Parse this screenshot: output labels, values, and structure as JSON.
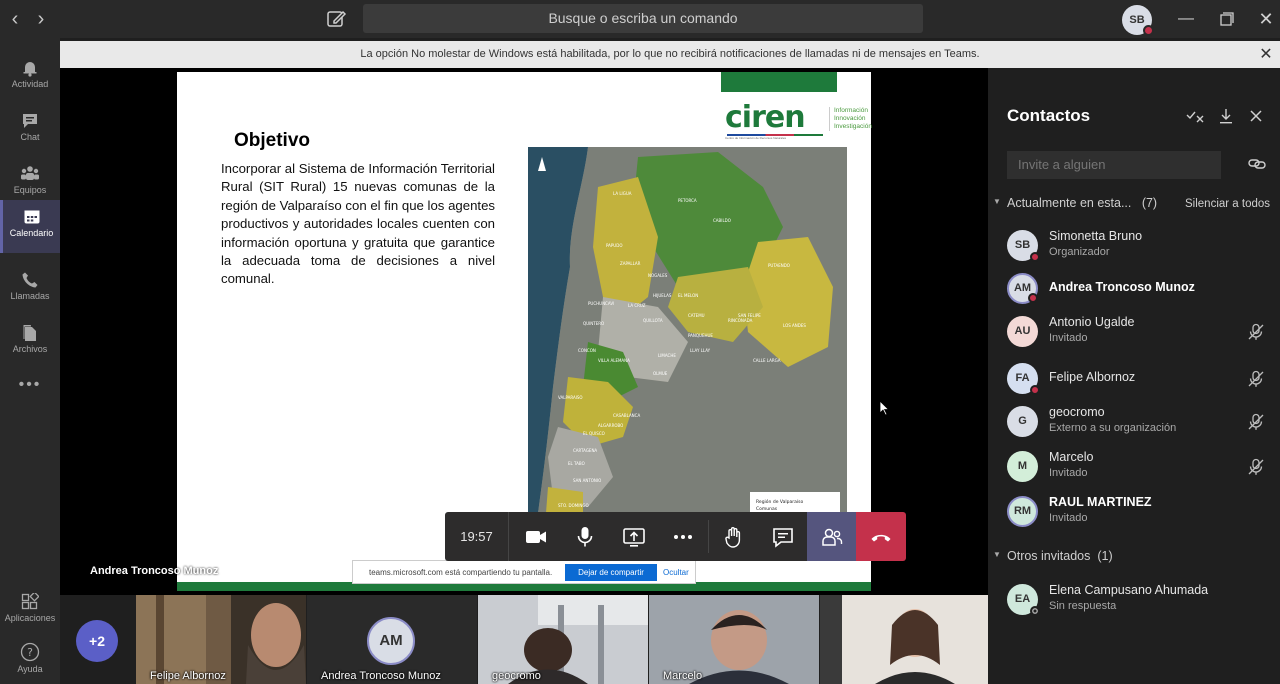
{
  "titlebar": {
    "search_placeholder": "Busque o escriba un comando",
    "me_initials": "SB"
  },
  "rail": {
    "items": [
      {
        "label": "Actividad",
        "icon": "bell-icon"
      },
      {
        "label": "Chat",
        "icon": "chat-icon"
      },
      {
        "label": "Equipos",
        "icon": "teams-icon"
      },
      {
        "label": "Calendario",
        "icon": "calendar-icon"
      },
      {
        "label": "Llamadas",
        "icon": "phone-icon"
      },
      {
        "label": "Archivos",
        "icon": "file-icon"
      }
    ],
    "bottom": [
      {
        "label": "Aplicaciones",
        "icon": "apps-icon"
      },
      {
        "label": "Ayuda",
        "icon": "help-icon"
      }
    ]
  },
  "banner": {
    "text": "La opción No molestar de Windows está habilitada, por lo que no recibirá notificaciones de llamadas ni de mensajes en Teams."
  },
  "slide": {
    "title": "Objetivo",
    "body": "Incorporar al Sistema de Información Territorial Rural (SIT Rural) 15 nuevas comunas de la región de Valparaíso con el fin que los agentes productivos y autoridades locales cuenten con información oportuna y gratuita que garantice la adecuada toma de decisiones a nivel comunal.",
    "logo_word": "ciren",
    "logo_sub": "Centro de Información de Recursos Naturales",
    "logo_tag": [
      "Información",
      "Innovación",
      "Investigación"
    ],
    "map_legend": [
      "Región de Valparaíso",
      "Comunas"
    ],
    "map_labels": [
      "LA LIGUA",
      "PETORCA",
      "CABILDO",
      "ZAPALLAR",
      "PAPUDO",
      "NOGALES",
      "HIJUELAS",
      "LA CRUZ",
      "QUILLOTA",
      "EL MELON",
      "CATEMU",
      "PANQUEHUE",
      "LLAY LLAY",
      "PUTAENDO",
      "SAN FELIPE",
      "LOS ANDES",
      "CALLE LARGA",
      "RINCONADA",
      "LIMACHE",
      "OLMUE",
      "VALPARAISO",
      "CASABLANCA",
      "CARTAGENA",
      "EL TABO",
      "EL QUISCO",
      "SAN ANTONIO",
      "STO. DOMINGO",
      "ALGARROBO",
      "QUINTERO",
      "PUCHUNCAVI",
      "CONCON",
      "VILLA ALEMANA"
    ]
  },
  "presenter_name": "Andrea Troncoso Munoz",
  "share": {
    "message": "teams.microsoft.com está compartiendo tu pantalla.",
    "stop": "Dejar de compartir",
    "hide": "Ocultar"
  },
  "controls": {
    "timer": "19:57"
  },
  "panel": {
    "title": "Contactos",
    "invite_placeholder": "Invite a alguien",
    "current_section": "Actualmente en esta...",
    "current_count": "(7)",
    "mute_all": "Silenciar a todos",
    "participants": [
      {
        "initials": "SB",
        "name": "Simonetta Bruno",
        "sub": "Organizador",
        "bg": "#d9dde6",
        "status": "#c4314b",
        "bold": false,
        "ring": false,
        "mic": false
      },
      {
        "initials": "AM",
        "name": "Andrea Troncoso Munoz",
        "sub": "",
        "bg": "#d9dde6",
        "status": "#c4314b",
        "bold": true,
        "ring": true,
        "mic": false
      },
      {
        "initials": "AU",
        "name": "Antonio Ugalde",
        "sub": "Invitado",
        "bg": "#f3d9d6",
        "status": "",
        "bold": false,
        "ring": false,
        "mic": true
      },
      {
        "initials": "FA",
        "name": "Felipe Albornoz",
        "sub": "",
        "bg": "#d5dff0",
        "status": "#c4314b",
        "bold": false,
        "ring": false,
        "mic": true
      },
      {
        "initials": "G",
        "name": "geocromo",
        "sub": "Externo a su organización",
        "bg": "#d9dde6",
        "status": "",
        "bold": false,
        "ring": false,
        "mic": true
      },
      {
        "initials": "M",
        "name": "Marcelo",
        "sub": "Invitado",
        "bg": "#d3eed9",
        "status": "",
        "bold": false,
        "ring": false,
        "mic": true
      },
      {
        "initials": "RM",
        "name": "RAUL MARTINEZ",
        "sub": "Invitado",
        "bg": "#cfe8dc",
        "status": "",
        "bold": true,
        "ring": true,
        "mic": false
      }
    ],
    "others_section": "Otros invitados",
    "others_count": "(1)",
    "others": [
      {
        "initials": "EA",
        "name": "Elena Campusano Ahumada",
        "sub": "Sin respuesta",
        "bg": "#cfe8dc",
        "status": "#1f1f1f"
      }
    ]
  },
  "filmstrip": {
    "more": "+2",
    "tiles": [
      {
        "name": "Felipe Albornoz",
        "kind": "video"
      },
      {
        "name": "Andrea Troncoso Munoz",
        "kind": "avatar",
        "initials": "AM"
      },
      {
        "name": "geocromo",
        "kind": "video"
      },
      {
        "name": "Marcelo",
        "kind": "video"
      },
      {
        "name": "",
        "kind": "video"
      }
    ]
  }
}
